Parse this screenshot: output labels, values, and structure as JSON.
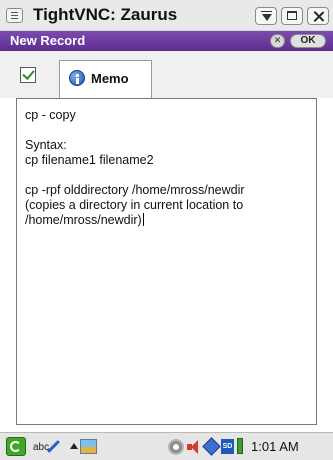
{
  "window": {
    "title": "TightVNC: Zaurus"
  },
  "app": {
    "title": "New Record",
    "close_label": "✕",
    "ok_label": "OK"
  },
  "tabs": {
    "memo_label": "Memo"
  },
  "memo": {
    "lines": [
      "cp - copy",
      "",
      "Syntax:",
      "cp filename1 filename2",
      "",
      "cp -rpf olddirectory /home/mross/newdir",
      "(copies a directory in current location to",
      "/home/mross/newdir)"
    ]
  },
  "taskbar": {
    "keyboard_label": "abc",
    "clock": "1:01 AM",
    "sd_label": "SD"
  }
}
